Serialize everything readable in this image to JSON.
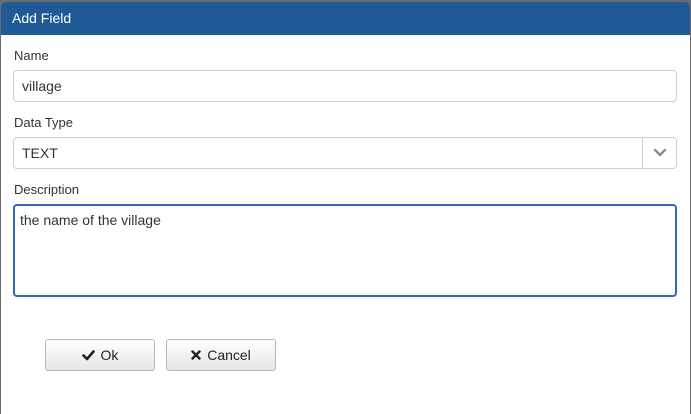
{
  "dialog": {
    "title": "Add Field"
  },
  "form": {
    "name_label": "Name",
    "name_value": "village",
    "data_type_label": "Data Type",
    "data_type_value": "TEXT",
    "description_label": "Description",
    "description_value": "the name of the village"
  },
  "buttons": {
    "ok_label": "Ok",
    "cancel_label": "Cancel"
  },
  "icons": {
    "ok": "check-icon",
    "cancel": "x-icon",
    "select": "chevron-down-icon"
  },
  "colors": {
    "titlebar": "#1f5a96",
    "focus_border": "#2a6db0"
  }
}
